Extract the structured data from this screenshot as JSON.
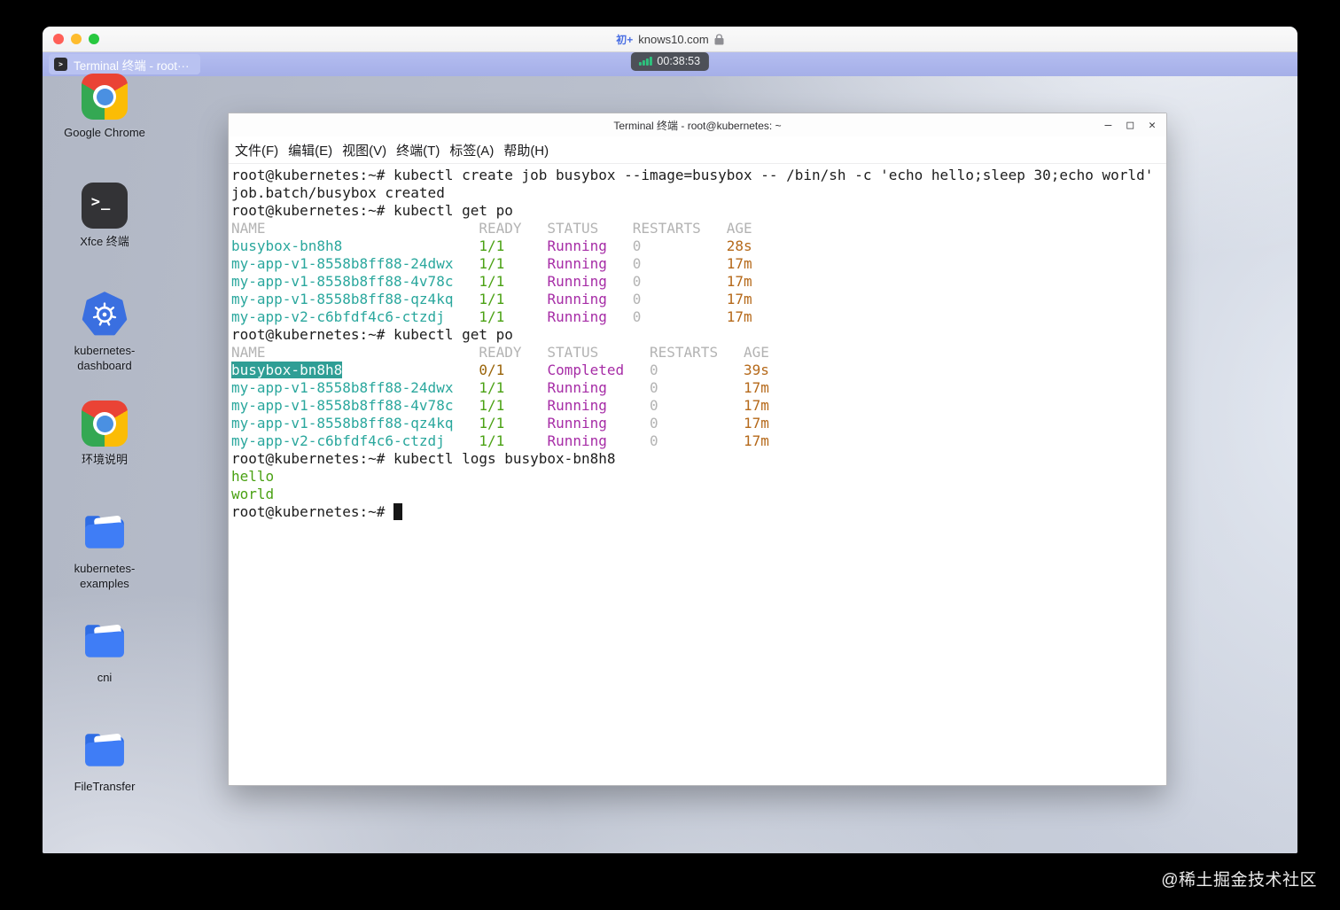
{
  "browser": {
    "favicon_text": "初+",
    "url": "knows10.com"
  },
  "timer": {
    "value": "00:38:53"
  },
  "desktop": {
    "icons": [
      {
        "label": "Google Chrome",
        "type": "chrome"
      },
      {
        "label": "Xfce 终端",
        "type": "terminal"
      },
      {
        "label": "kubernetes-dashboard",
        "type": "kubernetes"
      },
      {
        "label": "环境说明",
        "type": "chrome"
      },
      {
        "label": "kubernetes-examples",
        "type": "folder"
      },
      {
        "label": "cni",
        "type": "folder"
      },
      {
        "label": "FileTransfer",
        "type": "folder"
      }
    ]
  },
  "terminal_window": {
    "title": "Terminal 终端 - root@kubernetes: ~",
    "controls": {
      "minimize": "–",
      "maximize": "□",
      "close": "✕"
    },
    "menu": [
      "文件(F)",
      "编辑(E)",
      "视图(V)",
      "终端(T)",
      "标签(A)",
      "帮助(H)"
    ],
    "lines": [
      [
        [
          "root@kubernetes:~# kubectl create job busybox --image=busybox -- /bin/sh -c 'echo hello;sleep 30;echo world'",
          "d"
        ]
      ],
      [
        [
          "job.batch/busybox created",
          "d"
        ]
      ],
      [
        [
          "root@kubernetes:~# kubectl get po",
          "d"
        ]
      ],
      [
        [
          "NAME                         READY   STATUS    RESTARTS   AGE",
          "h"
        ]
      ],
      [
        [
          "busybox-bn8h8",
          "n"
        ],
        [
          "                ",
          "d"
        ],
        [
          "1/1",
          "g"
        ],
        [
          "     ",
          "d"
        ],
        [
          "Running",
          "m"
        ],
        [
          "   ",
          "d"
        ],
        [
          "0",
          "h"
        ],
        [
          "          ",
          "d"
        ],
        [
          "28s",
          "o"
        ]
      ],
      [
        [
          "my-app-v1-8558b8ff88-24dwx",
          "n"
        ],
        [
          "   ",
          "d"
        ],
        [
          "1/1",
          "g"
        ],
        [
          "     ",
          "d"
        ],
        [
          "Running",
          "m"
        ],
        [
          "   ",
          "d"
        ],
        [
          "0",
          "h"
        ],
        [
          "          ",
          "d"
        ],
        [
          "17m",
          "o"
        ]
      ],
      [
        [
          "my-app-v1-8558b8ff88-4v78c",
          "n"
        ],
        [
          "   ",
          "d"
        ],
        [
          "1/1",
          "g"
        ],
        [
          "     ",
          "d"
        ],
        [
          "Running",
          "m"
        ],
        [
          "   ",
          "d"
        ],
        [
          "0",
          "h"
        ],
        [
          "          ",
          "d"
        ],
        [
          "17m",
          "o"
        ]
      ],
      [
        [
          "my-app-v1-8558b8ff88-qz4kq",
          "n"
        ],
        [
          "   ",
          "d"
        ],
        [
          "1/1",
          "g"
        ],
        [
          "     ",
          "d"
        ],
        [
          "Running",
          "m"
        ],
        [
          "   ",
          "d"
        ],
        [
          "0",
          "h"
        ],
        [
          "          ",
          "d"
        ],
        [
          "17m",
          "o"
        ]
      ],
      [
        [
          "my-app-v2-c6bfdf4c6-ctzdj",
          "n"
        ],
        [
          "    ",
          "d"
        ],
        [
          "1/1",
          "g"
        ],
        [
          "     ",
          "d"
        ],
        [
          "Running",
          "m"
        ],
        [
          "   ",
          "d"
        ],
        [
          "0",
          "h"
        ],
        [
          "          ",
          "d"
        ],
        [
          "17m",
          "o"
        ]
      ],
      [
        [
          "root@kubernetes:~# kubectl get po",
          "d"
        ]
      ],
      [
        [
          "NAME                         READY   STATUS      RESTARTS   AGE",
          "h"
        ]
      ],
      [
        [
          "busybox-bn8h8",
          "s"
        ],
        [
          "                ",
          "d"
        ],
        [
          "0/1",
          "w"
        ],
        [
          "     ",
          "d"
        ],
        [
          "Completed",
          "m"
        ],
        [
          "   ",
          "d"
        ],
        [
          "0",
          "h"
        ],
        [
          "          ",
          "d"
        ],
        [
          "39s",
          "o"
        ]
      ],
      [
        [
          "my-app-v1-8558b8ff88-24dwx",
          "n"
        ],
        [
          "   ",
          "d"
        ],
        [
          "1/1",
          "g"
        ],
        [
          "     ",
          "d"
        ],
        [
          "Running",
          "m"
        ],
        [
          "     ",
          "d"
        ],
        [
          "0",
          "h"
        ],
        [
          "          ",
          "d"
        ],
        [
          "17m",
          "o"
        ]
      ],
      [
        [
          "my-app-v1-8558b8ff88-4v78c",
          "n"
        ],
        [
          "   ",
          "d"
        ],
        [
          "1/1",
          "g"
        ],
        [
          "     ",
          "d"
        ],
        [
          "Running",
          "m"
        ],
        [
          "     ",
          "d"
        ],
        [
          "0",
          "h"
        ],
        [
          "          ",
          "d"
        ],
        [
          "17m",
          "o"
        ]
      ],
      [
        [
          "my-app-v1-8558b8ff88-qz4kq",
          "n"
        ],
        [
          "   ",
          "d"
        ],
        [
          "1/1",
          "g"
        ],
        [
          "     ",
          "d"
        ],
        [
          "Running",
          "m"
        ],
        [
          "     ",
          "d"
        ],
        [
          "0",
          "h"
        ],
        [
          "          ",
          "d"
        ],
        [
          "17m",
          "o"
        ]
      ],
      [
        [
          "my-app-v2-c6bfdf4c6-ctzdj",
          "n"
        ],
        [
          "    ",
          "d"
        ],
        [
          "1/1",
          "g"
        ],
        [
          "     ",
          "d"
        ],
        [
          "Running",
          "m"
        ],
        [
          "     ",
          "d"
        ],
        [
          "0",
          "h"
        ],
        [
          "          ",
          "d"
        ],
        [
          "17m",
          "o"
        ]
      ],
      [
        [
          "root@kubernetes:~# kubectl logs busybox-bn8h8",
          "d"
        ]
      ],
      [
        [
          "hello",
          "g"
        ]
      ],
      [
        [
          "world",
          "g"
        ]
      ],
      [
        [
          "root@kubernetes:~# ",
          "d"
        ],
        [
          " ",
          "cur"
        ]
      ]
    ]
  },
  "taskbar": {
    "items": [
      {
        "label": "Terminal 终端 - root···"
      }
    ]
  },
  "frame": {
    "watermark": "@稀土掘金技术社区"
  },
  "colors": {
    "pod_name": "#2aa79d",
    "ready_ok": "#4aa113",
    "status": "#a62ca6",
    "age": "#b5691a",
    "ready_warn": "#996308",
    "selection_bg": "#2f9e95",
    "taskbar": "#a9b3ea",
    "kubernetes_blue": "#3a6fe0",
    "folder_blue": "#3f7df6",
    "signal_green": "#2ec27e"
  }
}
